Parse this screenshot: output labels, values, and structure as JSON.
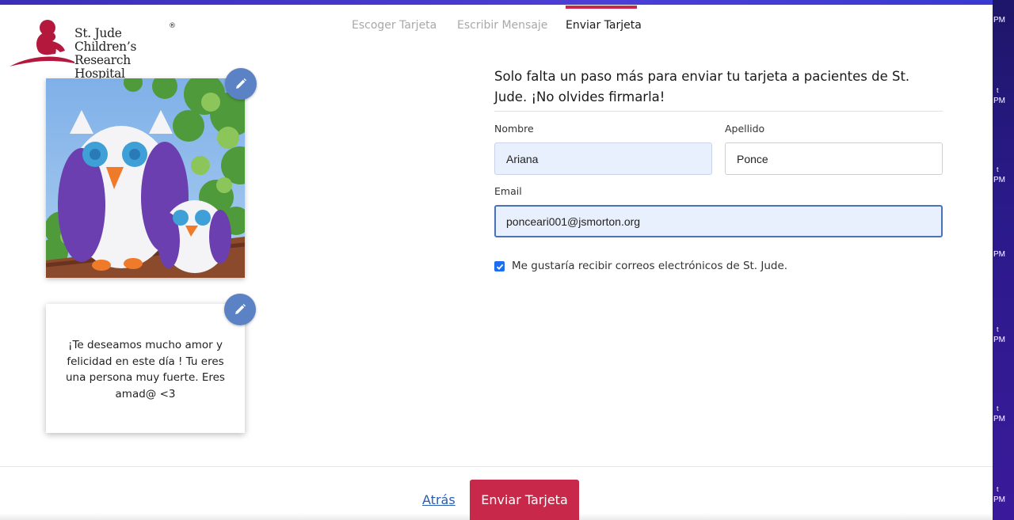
{
  "header": {
    "logo_line1": "St. Jude Children’s",
    "logo_line2": "Research Hospital",
    "logo_reg": "®"
  },
  "steps": [
    {
      "label": "Escoger Tarjeta",
      "active": false
    },
    {
      "label": "Escribir Mensaje",
      "active": false
    },
    {
      "label": "Enviar Tarjeta",
      "active": true
    }
  ],
  "preview": {
    "message": "¡Te deseamos mucho amor y felicidad en este día ! Tu eres una persona muy fuerte. Eres amad@ <3"
  },
  "form": {
    "title": "Solo falta un paso más para enviar tu tarjeta a pacientes de St. Jude. ¡No olvides firmarla!",
    "first_name_label": "Nombre",
    "first_name_value": "Ariana",
    "last_name_label": "Apellido",
    "last_name_value": "Ponce",
    "email_label": "Email",
    "email_value": "ponceari001@jsmorton.org",
    "opt_in_label": "Me gustaría recibir correos electrónicos de St. Jude.",
    "opt_in_checked": true
  },
  "footer": {
    "back_label": "Atrás",
    "send_label": "Enviar Tarjeta"
  },
  "background_strip": {
    "labels": [
      "PM",
      "PM",
      "PM",
      "PM",
      "PM",
      "PM",
      "PM"
    ]
  },
  "colors": {
    "accent": "#c8284a",
    "link": "#2a5db0",
    "edit_button": "#5b82c4",
    "checkbox": "#1b6ef0",
    "topbar": "#4b3fd6"
  }
}
